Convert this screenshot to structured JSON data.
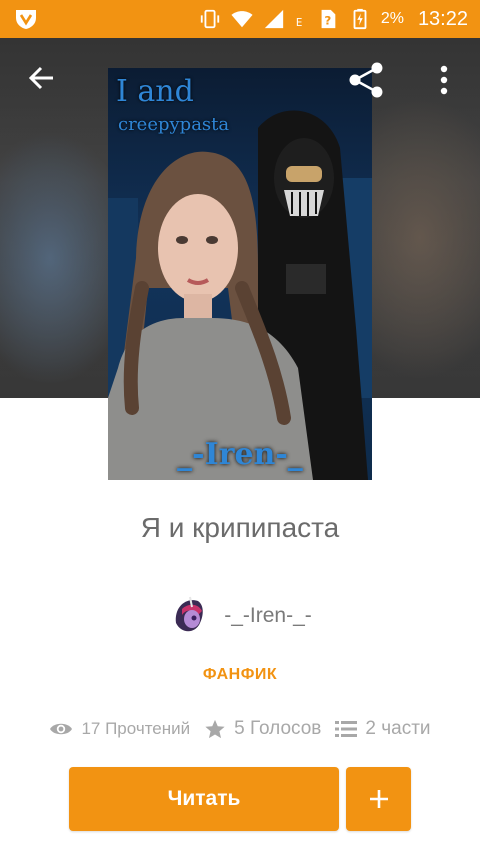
{
  "status_bar": {
    "battery": "2%",
    "time": "13:22"
  },
  "toolbar": {
    "back_icon": "arrow-left-icon",
    "share_icon": "share-icon",
    "more_icon": "more-vert-icon"
  },
  "cover": {
    "title": "I and",
    "subtitle": "creepypasta",
    "author": "_-Iren-_"
  },
  "story": {
    "title": "Я и крипипаста",
    "author": "-_-Iren-_-",
    "category": "ФАНФИК"
  },
  "stats": {
    "reads": "17 Прочтений",
    "votes": "5 Голосов",
    "parts": "2 части"
  },
  "actions": {
    "read_label": "Читать",
    "add_label": "+"
  },
  "colors": {
    "accent": "#f29312",
    "text_muted": "#a8a8a8",
    "title_text": "#6b6b6b"
  }
}
